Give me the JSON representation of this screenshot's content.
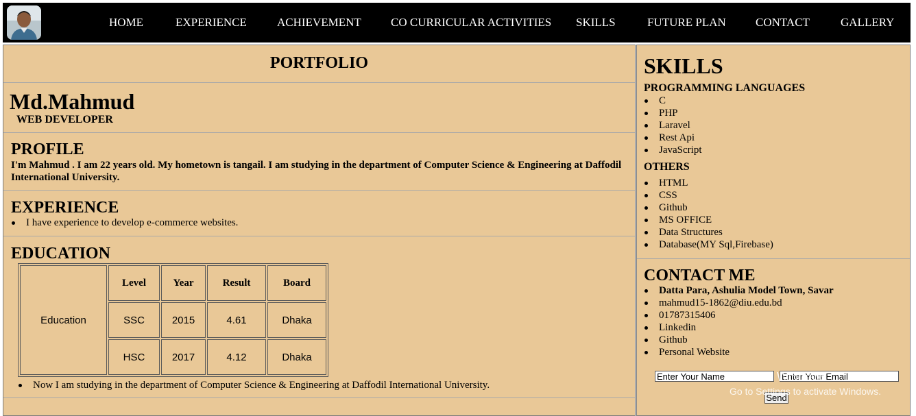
{
  "nav": {
    "items": [
      "HOME",
      "EXPERIENCE",
      "ACHIEVEMENT",
      "CO CURRICULAR ACTIVITIES",
      "SKILLS",
      "FUTURE PLAN",
      "CONTACT",
      "GALLERY"
    ]
  },
  "main": {
    "portfolio_title": "PORTFOLIO",
    "name": "Md.Mahmud",
    "role": "WEB DEVELOPER",
    "profile": {
      "heading": "PROFILE",
      "text": "I'm Mahmud . I am 22 years old. My hometown is tangail. I am studying in the department of Computer Science & Engineering at Daffodil International University."
    },
    "experience": {
      "heading": "EXPERIENCE",
      "items": [
        "I have experience to develop e-commerce websites."
      ]
    },
    "education": {
      "heading": "EDUCATION",
      "row_label": "Education",
      "headers": [
        "Level",
        "Year",
        "Result",
        "Board"
      ],
      "rows": [
        [
          "SSC",
          "2015",
          "4.61",
          "Dhaka"
        ],
        [
          "HSC",
          "2017",
          "4.12",
          "Dhaka"
        ]
      ],
      "note": "Now I am studying in the department of Computer Science & Engineering at Daffodil International University."
    }
  },
  "sidebar": {
    "skills_heading": "SKILLS",
    "programming_heading": "PROGRAMMING LANGUAGES",
    "programming": [
      "C",
      "PHP",
      "Laravel",
      "Rest Api",
      "JavaScript"
    ],
    "others_heading": "OTHERS",
    "others": [
      "HTML",
      "CSS",
      "Github",
      "MS OFFICE",
      "Data Structures",
      "Database(MY Sql,Firebase)"
    ],
    "contact_heading": "CONTACT ME",
    "contact": {
      "address": "Datta Para, Ashulia Model Town, Savar",
      "email": "mahmud15-1862@diu.edu.bd",
      "phone": "01787315406",
      "linkedin": "Linkedin",
      "github": "Github",
      "website": "Personal Website"
    },
    "form": {
      "name_placeholder": "Enter Your Name",
      "email_placeholder": "Enter Your Email",
      "send_label": "Send"
    }
  },
  "watermark": {
    "line1": "Activate Windows",
    "line2": "Go to Settings to activate Windows."
  }
}
